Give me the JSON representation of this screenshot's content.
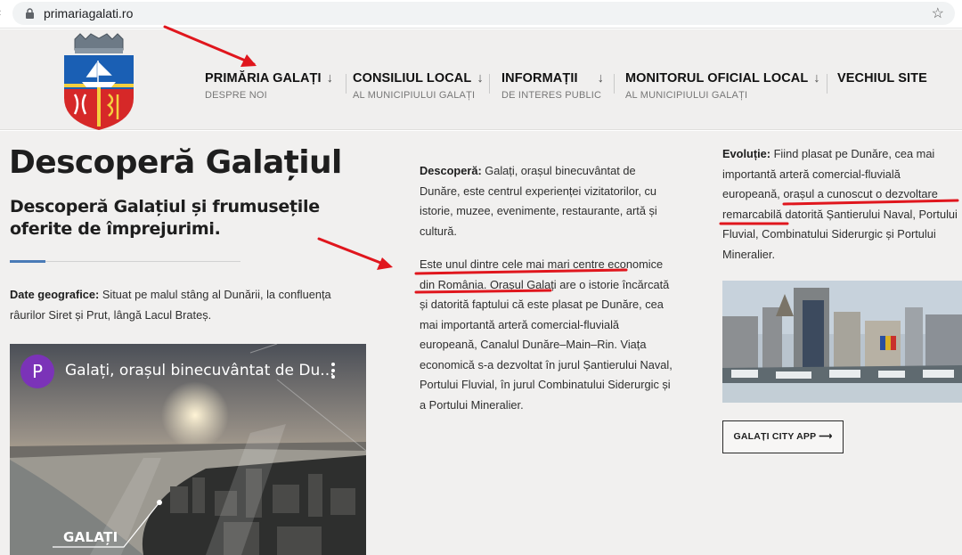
{
  "browser": {
    "url": "primariagalati.ro",
    "back_icon": "chevron-left-icon",
    "lock_icon": "lock-icon",
    "bookmark_icon": "star-outline-icon"
  },
  "nav": {
    "items": [
      {
        "title": "PRIMĂRIA GALAȚI",
        "arrow": "↓",
        "subtitle": "DESPRE NOI"
      },
      {
        "title": "CONSILIUL LOCAL",
        "arrow": "↓",
        "subtitle": "AL MUNICIPIULUI GALAȚI"
      },
      {
        "title": "INFORMAȚII",
        "arrow": "↓",
        "subtitle": "DE INTERES PUBLIC"
      },
      {
        "title": "MONITORUL OFICIAL LOCAL",
        "arrow": "↓",
        "subtitle": "AL MUNICIPIULUI GALAȚI"
      },
      {
        "title": "VECHIUL SITE"
      }
    ]
  },
  "hero": {
    "title": "Descoperă Galațiul",
    "subtitle": "Descoperă Galațiul și frumusețile oferite de împrejurimi."
  },
  "geo": {
    "label": "Date geografice:",
    "text": " Situat pe malul stâng al Dunării, la confluența râurilor Siret și Prut, lângă Lacul Brateș."
  },
  "video": {
    "avatar_letter": "P",
    "title": "Galați, orașul binecuvântat de Du...",
    "overlay_label": "GALAȚI",
    "menu_icon": "more-vertical-icon"
  },
  "discover": {
    "label": "Descoperă:",
    "text": " Galați, orașul binecuvântat de Dunăre, este centrul experienței vizitatorilor, cu istorie, muzee, evenimente, restaurante, artă și cultură.",
    "para2_highlight": "Este unul dintre cele mai mari centre economice din România",
    "para2_rest": ". Orașul Galați are o istorie încărcată și datorită faptului că este plasat pe Dunăre, cea mai importantă arteră comercial-fluvială europeană, Canalul Dunăre–Main–Rin. Viața economică s-a dezvoltat în jurul Șantierului Naval, Portului Fluvial, în jurul Combinatului Siderurgic și a Portului Mineralier."
  },
  "evolution": {
    "label": "Evoluție:",
    "text_before": " Fiind plasat pe Dunăre, cea mai importantă arteră comercial-fluvială europeană, ",
    "highlight": "orașul a cunoscut o dezvoltare remarcabilă",
    "text_after": " datorită Șantierului Naval, Portului Fluvial, Combinatului Siderurgic și Portului Mineralier."
  },
  "app_button": {
    "label": "GALAȚI CITY APP",
    "arrow": "⟶"
  },
  "colors": {
    "annotation_red": "#e0161d",
    "accent_blue": "#4a7bb7",
    "header_bg": "#f0efee",
    "avatar_purple": "#7b33b8"
  }
}
